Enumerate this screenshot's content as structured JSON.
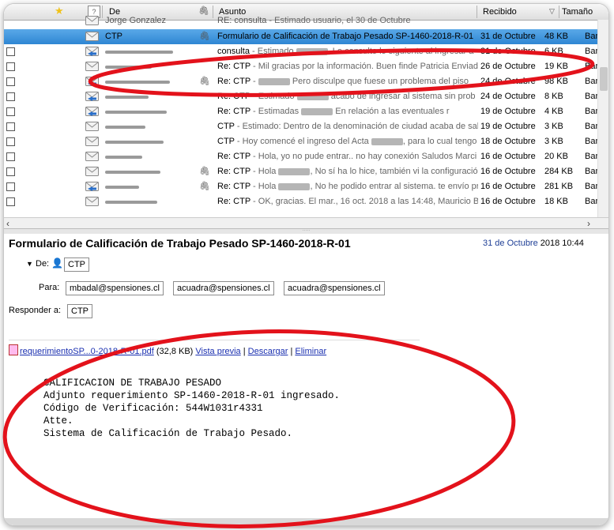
{
  "columns": {
    "from": "De",
    "subject": "Asunto",
    "received": "Recibido",
    "size": "Tamaño"
  },
  "rows": [
    {
      "sender": "Jorge Gonzalez",
      "subject": "RE: consulta",
      "snippet": " - Estimado usuario, el 30 de Octubre",
      "date": "",
      "size": "",
      "acct": "",
      "partial": true
    },
    {
      "sender": "CTP",
      "subject": "Formulario de Calificación de Trabajo Pesado SP-1460-2018-R-01",
      "snippet": "",
      "date": "31 de Octubre",
      "size": "48 KB",
      "acct": "Ban",
      "selected": true,
      "attach": true
    },
    {
      "sender": "",
      "subject": "consulta",
      "snippet": " - Estimado ",
      "snippet2": ", Le consulto lo siguiente al ingresar a",
      "date": "31 de Octubre",
      "size": "6 KB",
      "acct": "Ban",
      "reply": true,
      "blur": true
    },
    {
      "sender": "",
      "subject": "Re: CTP",
      "snippet": " - Mil gracias por la información. Buen finde Patricia Enviado",
      "date": "26 de Octubre",
      "size": "19 KB",
      "acct": "Ban"
    },
    {
      "sender": "",
      "subject": "Re: CTP",
      "snippet": " - ",
      "snippet2": " Pero disculpe que fuese un problema del piso",
      "date": "24 de Octubre",
      "size": "98 KB",
      "acct": "Ban",
      "reply": true,
      "attach": true,
      "blur": true
    },
    {
      "sender": "",
      "subject": "Re: CTP",
      "snippet": " - Estimado ",
      "snippet2": " acabo de ingresar al sistema sin prob",
      "date": "24 de Octubre",
      "size": "8 KB",
      "acct": "Ban",
      "reply": true,
      "blur": true
    },
    {
      "sender": "",
      "subject": "Re: CTP",
      "snippet": " - Estimadas ",
      "snippet2": " En relación a las eventuales r",
      "date": "19 de Octubre",
      "size": "4 KB",
      "acct": "Ban",
      "reply": true,
      "blur": true
    },
    {
      "sender": "",
      "subject": "CTP",
      "snippet": " - Estimado: Dentro de la denominación de ciudad acaba de sali",
      "date": "19 de Octubre",
      "size": "3 KB",
      "acct": "Ban"
    },
    {
      "sender": "",
      "subject": "CTP",
      "snippet": " - Hoy comencé el ingreso del Acta ",
      "snippet2": ", para lo cual tengo la",
      "date": "18 de Octubre",
      "size": "3 KB",
      "acct": "Ban",
      "blur": true
    },
    {
      "sender": "",
      "subject": "Re: CTP",
      "snippet": " - Hola, yo no pude entrar.. no hay conexión Saludos Marci",
      "date": "16 de Octubre",
      "size": "20 KB",
      "acct": "Ban"
    },
    {
      "sender": "",
      "subject": "Re: CTP",
      "snippet": " - Hola ",
      "snippet2": ", No sí ha lo hice, también vi la configuració",
      "date": "16 de Octubre",
      "size": "284 KB",
      "acct": "Ban",
      "attach": true,
      "blur": true
    },
    {
      "sender": "",
      "subject": "Re: CTP",
      "snippet": " - Hola ",
      "snippet2": ", No he podido entrar al sistema. te envío pr",
      "date": "16 de Octubre",
      "size": "281 KB",
      "acct": "Ban",
      "reply": true,
      "attach": true,
      "blur": true
    },
    {
      "sender": "",
      "subject": "Re: CTP",
      "snippet": " - OK, gracias. El mar., 16 oct. 2018 a las 14:48, Mauricio B",
      "date": "16 de Octubre",
      "size": "18 KB",
      "acct": "Ban"
    }
  ],
  "preview": {
    "title": "Formulario de Calificación de Trabajo Pesado SP-1460-2018-R-01",
    "date": "31 de Octubre",
    "time": "2018 10:44",
    "from_label": "De:",
    "from": "CTP",
    "to_label": "Para:",
    "to": [
      "mbadal@spensiones.cl",
      "acuadra@spensiones.cl",
      "acuadra@spensiones.cl"
    ],
    "reply_label": "Responder a:",
    "reply_to": "CTP",
    "attachment": {
      "name": "requerimientoSP...0-2018-R-01.pdf",
      "size": "(32,8 KB)",
      "preview": "Vista previa",
      "download": "Descargar",
      "delete": "Eliminar"
    },
    "body": [
      "CALIFICACION DE TRABAJO PESADO",
      "",
      "Adjunto requerimiento SP-1460-2018-R-01 ingresado.",
      "Código de Verificación: 544W1031r4331",
      "",
      "Atte.",
      "Sistema de Calificación de Trabajo Pesado."
    ]
  },
  "annotation_color": "#e3121b"
}
